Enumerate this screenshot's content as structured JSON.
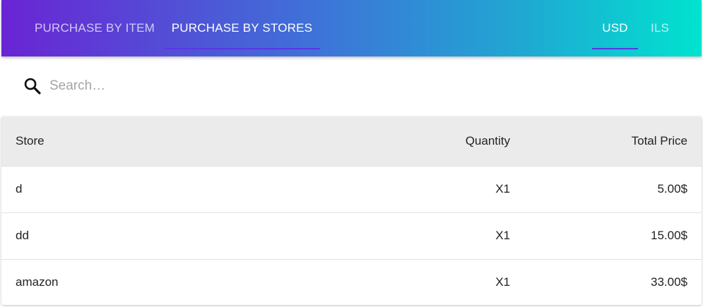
{
  "tabs": {
    "left": [
      {
        "label": "PURCHASE BY ITEM",
        "active": false
      },
      {
        "label": "PURCHASE BY STORES",
        "active": true
      }
    ],
    "currency": [
      {
        "label": "USD",
        "active": true
      },
      {
        "label": "ILS",
        "active": false
      }
    ]
  },
  "search": {
    "icon": "search-icon",
    "placeholder": "Search…",
    "value": ""
  },
  "table": {
    "headers": [
      "Store",
      "Quantity",
      "Total Price"
    ],
    "rows": [
      {
        "store": "d",
        "quantity": "X1",
        "total_price": "5.00$"
      },
      {
        "store": "dd",
        "quantity": "X1",
        "total_price": "15.00$"
      },
      {
        "store": "amazon",
        "quantity": "X1",
        "total_price": "33.00$"
      }
    ]
  },
  "colors": {
    "gradient_start": "#6a24d4",
    "gradient_end": "#00e3d0",
    "tab_indicator": "#5b35e6",
    "header_bg": "#ebebeb"
  }
}
